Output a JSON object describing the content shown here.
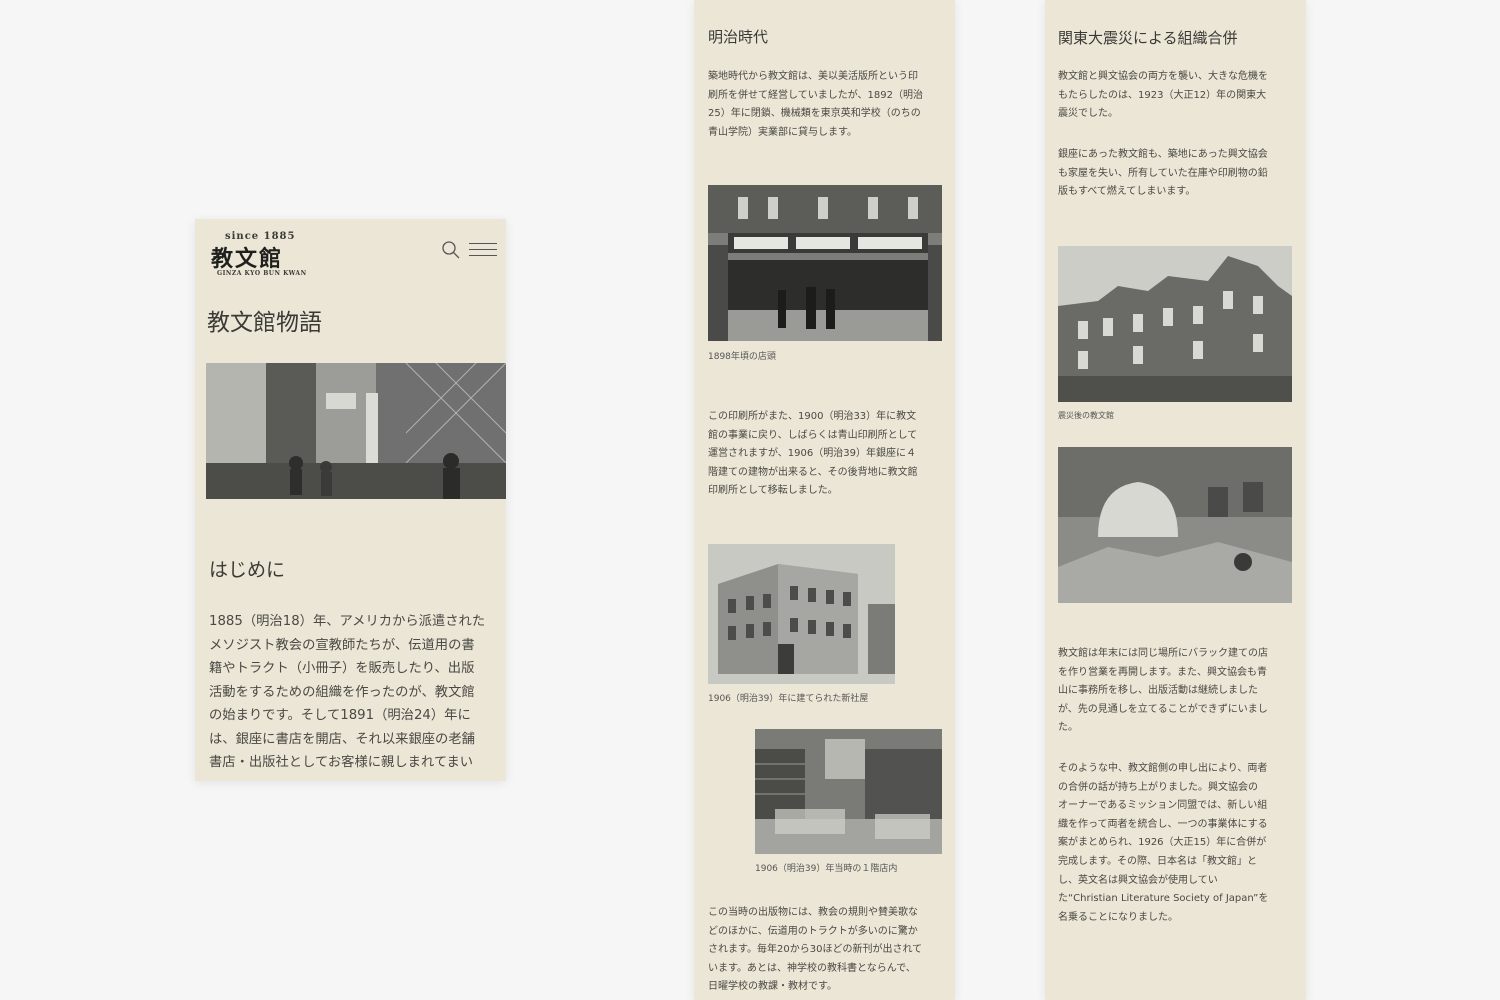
{
  "phone": {
    "logo": {
      "since": "since 1885",
      "name": "教文館",
      "sub": "GINZA KYO BUN KWAN"
    },
    "header": {
      "search_icon": "search-icon",
      "menu_icon": "hamburger-menu-icon"
    },
    "page_title": "教文館物語",
    "section_title": "はじめに",
    "body_lines": [
      "1885（明治18）年、アメリカから派遣された",
      "メソジスト教会の宣教師たちが、伝道用の書",
      "籍やトラクト（小冊子）を販売したり、出版",
      "活動をするための組織を作ったのが、教文館",
      "の始まりです。そして1891（明治24）年に",
      "は、銀座に書店を開店、それ以来銀座の老舗",
      "書店・出版社としてお客様に親しまれてまい"
    ]
  },
  "meiji": {
    "title": "明治時代",
    "para1": [
      "築地時代から教文館は、美以美活版所という印",
      "刷所を併せて経営していましたが、1892（明治",
      "25）年に閉鎖、機械類を東京英和学校（のちの",
      "青山学院）実業部に貸与します。"
    ],
    "caption1": "1898年頃の店頭",
    "para2": [
      "この印刷所がまた、1900（明治33）年に教文",
      "館の事業に戻り、しばらくは青山印刷所として",
      "運営されますが、1906（明治39）年銀座に４",
      "階建ての建物が出来ると、その後背地に教文館",
      "印刷所として移転しました。"
    ],
    "caption2": "1906（明治39）年に建てられた新社屋",
    "caption3": "1906（明治39）年当時の１階店内",
    "para3": [
      "この当時の出版物には、教会の規則や賛美歌な",
      "どのほかに、伝道用のトラクトが多いのに驚か",
      "されます。毎年20から30ほどの新刊が出されて",
      "います。あとは、神学校の教科書とならんで、",
      "日曜学校の教課・教材です。"
    ]
  },
  "kanto": {
    "title": "関東大震災による組織合併",
    "para1": [
      "教文館と興文協会の両方を襲い、大きな危機を",
      "もたらしたのは、1923（大正12）年の関東大",
      "震災でした。"
    ],
    "para2": [
      "銀座にあった教文館も、築地にあった興文協会",
      "も家屋を失い、所有していた在庫や印刷物の鉛",
      "版もすべて燃えてしまいます。"
    ],
    "caption1": "震災後の教文館",
    "para3": [
      "教文館は年末には同じ場所にバラック建ての店",
      "を作り営業を再開します。また、興文協会も青",
      "山に事務所を移し、出版活動は継続しました",
      "が、先の見通しを立てることができずにいまし",
      "た。"
    ],
    "para4": [
      "そのような中、教文館側の申し出により、両者",
      "の合併の話が持ち上がりました。興文協会の",
      "オーナーであるミッション同盟では、新しい組",
      "織を作って両者を統合し、一つの事業体にする",
      "案がまとめられ、1926（大正15）年に合併が",
      "完成します。その際、日本名は「教文館」と",
      "し、英文名は興文協会が使用してい",
      "た“Christian Literature Society of Japan”を",
      "名乗ることになりました。"
    ]
  }
}
